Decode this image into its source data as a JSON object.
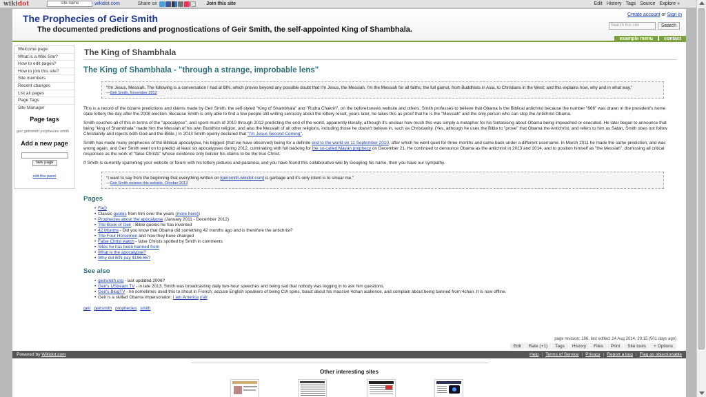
{
  "topbar": {
    "logo_a": "wiki",
    "logo_b": "dot",
    "site_name_placeholder": "site-name",
    "domain": ".wikidot.com",
    "share_label": "Share on",
    "join_label": "Join this site",
    "menu": [
      "Edit",
      "History",
      "Tags",
      "Source",
      "Explore »"
    ]
  },
  "header": {
    "title": "The Prophecies of Geir Smith",
    "subtitle": "The documented predictions and prognostications of Geir Smith, the self-appointed King of Shambhala.",
    "create_account": "Create account",
    "or": "or",
    "sign_in": "Sign in",
    "search_placeholder": "Search this site",
    "search_button": "Search"
  },
  "top_menu": [
    "example menu",
    "contact"
  ],
  "sidebar": {
    "items": [
      "Welcome page",
      "What is a Wiki Site?",
      "How to edit pages?",
      "How to join this site?",
      "Site members",
      "Recent changes",
      "List all pages",
      "Page Tags",
      "Site Manager"
    ],
    "page_tags_heading": "Page tags",
    "tags_text": "geir geirsmith prophecies smith",
    "add_page_heading": "Add a new page",
    "new_page_button": "new page",
    "edit_panel": "edit this panel"
  },
  "page": {
    "title": "The King of Shambhala",
    "heading": "The King of Shambhala - \"through a strange, improbable lens\"",
    "quote1": {
      "text": "\"I'm Jesus, Messiah. The following is a conversation I had at BIN, which proves beyond any possible doubt that I'm Jesus, the Messiah. I'm the Messiah for all faiths, the full gamut, from Buddhists in Asia, to Christians in the West; and this explains how, why and in what way.\"",
      "dash": "—",
      "source": "Geir Smith, November 2012"
    },
    "p1": "This is a record of the bizarre predictions and claims made by Geir Smith, the self-styled \"King of Shambhala\" and \"Rudra Chakrin\", on the beforeitsnews website and others. Smith professes to believe that Obama is the Biblical antichrist because the number \"666\" was drawn in the president's home state lottery the day after the 2008 election. Because Smith is only able to find a few people still writing seriously about the lottery result, years later, he takes this as proof that he is the \"Messiah\" and the only person who can stop the Antichrist Obama.",
    "p2": "Smith couches all of this in terms of the \"apocalypse\", and spent much of 2010 through 2012 predicting the end of the world, apparently literally, although it's unclear how much this was simply a metaphor for his fantasising about Obama being impeached or executed. He later began to announce that being \"king of Shambhala\" made him the Messiah of his own Buddhist religion, and also the Messiah of all other religions, including those he doesn't believe in, such as Christianity. (Yes, although he uses the Bible to \"prove\" that Obama the Antichrist, and refers to him as Satan, Smith does not follow Christianity and rejects both God and the Bible.) In 2013 Smith openly declared that",
    "p2_link": "\"I'm Jesus Second Coming\"",
    "p2_end": ".",
    "p3_a": "Smith has made many prophecies of the Biblical apocalypse, his biggest (that we have observed) being for a definite",
    "p3_link1": "end to the world on 11 September 2010",
    "p3_b": ", after which he went quiet for three months and came back under a different username. In March 2011 he made the same prediction, and was wrong again, and Geir Smith went on to predict at least six apocalypses during 2012, culminating with full backing for",
    "p3_link2": "the so-called Mayan prophecy",
    "p3_c": "on December 21. He continued to denounce Obama as the antichrist in 2013 and 2014, and to position himself as \"the Messiah\", dismissing all critical responses as the work of \"false Christs\" whose existence only bolster his claims to be the true Christ.",
    "p4": "If Smith is currently spamming your website or forum with his lottery pictures and paranoia, and you have found this collaborative wiki by Googling his name, then you have our sympathy.",
    "quote2": {
      "text_a": "\"I want to say from the beginning that everything written on",
      "link": "[geirsmith.wikidot.com]",
      "text_b": "is garbage and it's only intent is to smear me.\"",
      "dash": "—",
      "source": "Geir Smith reviews this website, October 2013"
    },
    "pages_heading": "Pages",
    "pages": [
      {
        "link": "FAQ",
        "text": ""
      },
      {
        "pre": "Classic",
        "link": "quotes",
        "text": "from him over the years",
        "link2": "(more here)",
        "post": ")"
      },
      {
        "link": "Prophecies about the apocalypse",
        "text": "(January 2011 - December 2012)"
      },
      {
        "link": "The Book of Geir",
        "text": "- Bible quotes he has invented"
      },
      {
        "link": "42 Months",
        "text": "- Did you know that Obama did something 42 months ago and is therefore the antichrist?"
      },
      {
        "link": "The Four Horsemen",
        "text": "and how they have changed"
      },
      {
        "link": "False Christ watch",
        "text": "- false Christs spotted by Smith in comments"
      },
      {
        "link": "Sites he has been banned from",
        "text": ""
      },
      {
        "link": "What is the apocalypse?",
        "text": ""
      },
      {
        "link": "Why did BIN pay $196.65?",
        "text": ""
      }
    ],
    "see_also_heading": "See also",
    "see_also": [
      {
        "link": "geirsmith.org",
        "text": "- last updated 2006?"
      },
      {
        "link": "Geir's UStream TV",
        "text": "- in late 2013, Smith was broadcasting daily two-hour speeches and being sad that nobody was logging in to ask him questions."
      },
      {
        "link": "Geir's BlogTV",
        "text": "- he sometimes used this to shout in French, accuse English speakers of being CIA spies, boast about his massive 4chan audience, and complain about being banned from 4chan. It is now offline."
      },
      {
        "pre": "Geir is a skilled Obama impersonator:",
        "link": "I am America",
        "link2": "y'all"
      }
    ],
    "tags": [
      "geir",
      "geirsmith",
      "prophecies",
      "smith"
    ],
    "page_info": "page revision: 196, last edited: 14 Aug 2014, 20:15 (501 days ago)",
    "options": [
      "Edit",
      "Rate (+1)",
      "Tags",
      "History",
      "Files",
      "Print",
      "Site tools",
      "+ Options"
    ]
  },
  "footer": {
    "powered_by": "Powered by",
    "wikidot": "Wikidot.com",
    "links": [
      "Help",
      "Terms of Service",
      "Privacy",
      "Report a bug",
      "Flag as objectionable"
    ],
    "other_sites": "Other interesting sites"
  },
  "colors": {
    "title_blue": "#1b3596",
    "heading_teal": "#2c6f78",
    "menu_green": "#7aa03e",
    "footer_gray": "#555555"
  }
}
